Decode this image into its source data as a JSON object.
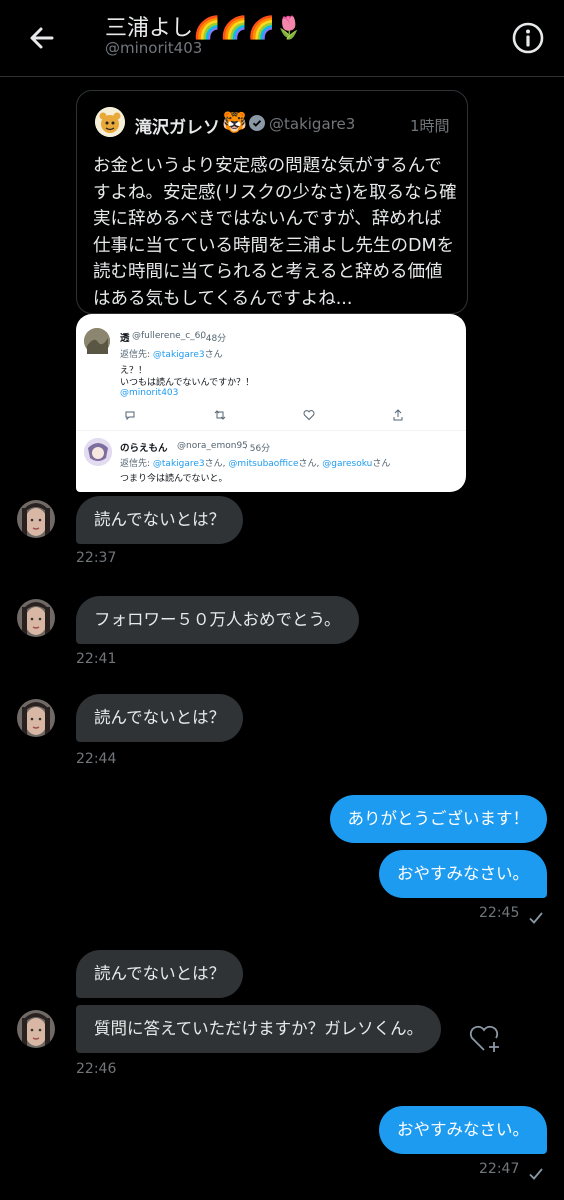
{
  "header": {
    "name": "三浦よし🌈🌈🌈🌷",
    "handle": "@minorit403",
    "back_icon": "arrow-left-icon",
    "info_icon": "info-icon"
  },
  "quote": {
    "name": "滝沢ガレソ",
    "badge_emoji": "🐯",
    "handle": "@takigare3",
    "time": "1時間",
    "text": "お金というより安定感の問題な気がするんですよね。安定感(リスクの少なさ)を取るなら確実に辞めるべきではないんですが、辞めれば仕事に当てている時間を三浦よし先生のDMを読む時間に当てられると考えると辞める価値はある気もしてくるんですよね..."
  },
  "screenshot": {
    "tweet1": {
      "name": "透",
      "handle": "@fullerene_c_60",
      "time": "· 48分",
      "reply_prefix": "返信先: ",
      "reply_to": "@takigare3",
      "reply_suffix": "さん",
      "line1": "え？！",
      "line2": "いつもは読んでないんですか？！",
      "mention": "@minorit403"
    },
    "tweet2": {
      "name": "のらえもん",
      "handle": "@nora_emon95",
      "time": "· 56分",
      "reply_prefix": "返信先: ",
      "reply_to_1": "@takigare3",
      "reply_sep_1": "さん, ",
      "reply_to_2": "@mitsubaoffice",
      "reply_sep_2": "さん, ",
      "reply_to_3": "@garesoku",
      "reply_suffix": "さん",
      "text": "つまり今は読んでないと。"
    }
  },
  "messages": [
    {
      "text": "読んでないとは？",
      "time": "22:37"
    },
    {
      "text": "フォロワー５０万人おめでとう。",
      "time": "22:41"
    },
    {
      "text": "読んでないとは？",
      "time": "22:44"
    },
    {
      "text": "ありがとうございます！"
    },
    {
      "text": "おやすみなさい。",
      "time": "22:45"
    },
    {
      "text": "読んでないとは？"
    },
    {
      "text": "質問に答えていただけますか？ガレソくん。",
      "time": "22:46"
    },
    {
      "text": "おやすみなさい。",
      "time": "22:47"
    }
  ],
  "colors": {
    "background": "#000000",
    "incoming_bubble": "#2f3336",
    "outgoing_bubble": "#1d9bf0",
    "secondary_text": "#71767b"
  }
}
